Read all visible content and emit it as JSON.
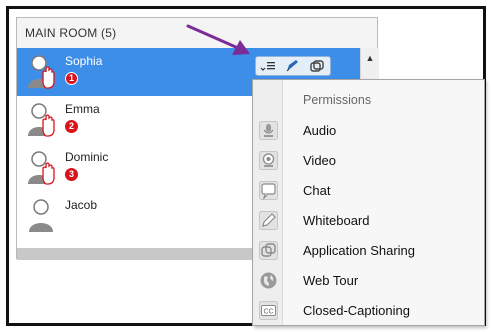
{
  "panel": {
    "title": "MAIN ROOM (5)"
  },
  "participants": [
    {
      "name": "Sophia",
      "badge": "1",
      "selected": true
    },
    {
      "name": "Emma",
      "badge": "2",
      "selected": false
    },
    {
      "name": "Dominic",
      "badge": "3",
      "selected": false
    },
    {
      "name": "Jacob",
      "badge": "",
      "selected": false
    }
  ],
  "actions": {
    "icons": [
      "permissions-menu-icon",
      "pencil-icon",
      "share-icon"
    ]
  },
  "menu": {
    "title": "Permissions",
    "items": [
      {
        "label": "Audio",
        "icon": "microphone-icon"
      },
      {
        "label": "Video",
        "icon": "webcam-icon"
      },
      {
        "label": "Chat",
        "icon": "chat-bubble-icon"
      },
      {
        "label": "Whiteboard",
        "icon": "pencil-icon"
      },
      {
        "label": "Application Sharing",
        "icon": "app-share-icon"
      },
      {
        "label": "Web Tour",
        "icon": "globe-icon"
      },
      {
        "label": "Closed-Captioning",
        "icon": "cc-icon"
      }
    ]
  },
  "colors": {
    "selected_row": "#3d8ee8",
    "badge": "#d9131c",
    "hand_icon": "#d9131c",
    "arrow": "#7b2c97"
  }
}
